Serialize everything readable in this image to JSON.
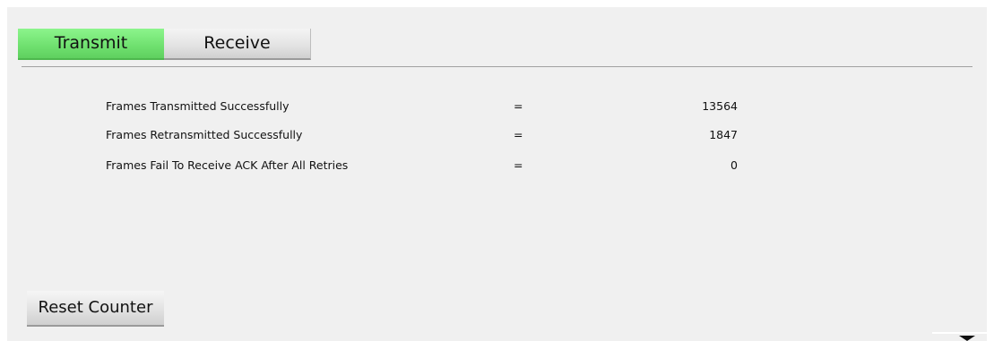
{
  "tabs": {
    "transmit_label": "Transmit",
    "receive_label": "Receive",
    "active": "Transmit",
    "active_color": "#6fe06f"
  },
  "stats": [
    {
      "label": "Frames Transmitted Successfully",
      "separator": "=",
      "value": "13564"
    },
    {
      "label": "Frames Retransmitted Successfully",
      "separator": "=",
      "value": "1847"
    },
    {
      "label": "Frames Fail To Receive ACK After All Retries",
      "separator": "=",
      "value": "0"
    }
  ],
  "actions": {
    "reset_label": "Reset Counter"
  },
  "icons": {
    "scroll_arrow": "triangle-down-icon"
  }
}
